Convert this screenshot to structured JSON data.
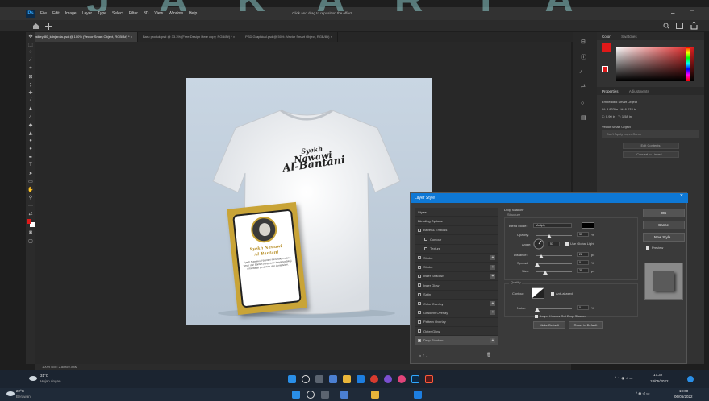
{
  "watermark": "JAKARTA",
  "menubar": {
    "logo": "Ps",
    "items": [
      "File",
      "Edit",
      "Image",
      "Layer",
      "Type",
      "Select",
      "Filter",
      "3D",
      "View",
      "Window",
      "Help"
    ],
    "hint": "Click and drag to reposition the effect.",
    "minimize": "–",
    "restore": "❐"
  },
  "tabs": [
    "postkey 80_kdnjardia.psd @ 100% (Vector Smart Object, RGB/8#) * ×",
    "Baru produk.psd @ 33.3% (Free Design Here copy, RGB/8#) * ×",
    "PSD Graphical.psd @ 50% (Vector Smart Object, RGB/8#) ×"
  ],
  "statusbar": "100%    Doc: 2.88M/2.88M",
  "shirt": {
    "print_line1": "Syekh",
    "print_line2": "Nawawi",
    "print_line3": "Al-Bantani"
  },
  "card": {
    "name_line1": "Syekh Nawawi",
    "name_line2": "Al-Bantani",
    "body": "Syekh Nawawi al-Bantani merupakan ulama besar dari Banten yang karya-karyanya dikaji di berbagai pesantren dan dunia Islam."
  },
  "right_panel": {
    "color_tab": "Color",
    "swatches_tab": "Swatches",
    "properties_tab": "Properties",
    "adjustments_tab": "Adjustments",
    "smart_object": "Embedded Smart Object",
    "w_label": "W:",
    "w_value": "5.833 in",
    "h_label": "H:",
    "h_value": "6.033 in",
    "x_value": "0.90 in",
    "y_value": "1.58 in",
    "vso_title": "Vector Smart Object",
    "vso_field": "Don't Apply Layer Comp",
    "edit_contents": "Edit Contents",
    "convert": "Convert to Linked..."
  },
  "dialog": {
    "title": "Layer Style",
    "close": "×",
    "styles": [
      {
        "label": "Styles",
        "type": "header"
      },
      {
        "label": "Blending Options",
        "type": "header"
      },
      {
        "label": "Bevel & Emboss",
        "checked": false
      },
      {
        "label": "Contour",
        "checked": false,
        "indent": true
      },
      {
        "label": "Texture",
        "checked": false,
        "indent": true
      },
      {
        "label": "Stroke",
        "checked": false,
        "plus": true
      },
      {
        "label": "Stroke",
        "checked": false,
        "plus": true
      },
      {
        "label": "Inner Shadow",
        "checked": false,
        "plus": true
      },
      {
        "label": "Inner Glow",
        "checked": false
      },
      {
        "label": "Satin",
        "checked": false
      },
      {
        "label": "Color Overlay",
        "checked": false,
        "plus": true
      },
      {
        "label": "Gradient Overlay",
        "checked": false,
        "plus": true
      },
      {
        "label": "Pattern Overlay",
        "checked": false
      },
      {
        "label": "Outer Glow",
        "checked": false
      },
      {
        "label": "Drop Shadow",
        "checked": true,
        "plus": true,
        "selected": true
      }
    ],
    "fx_icons": "fx  ⇡  ⇣",
    "trash": "🗑",
    "section": "Drop Shadow",
    "structure": "Structure",
    "blend_mode_label": "Blend Mode:",
    "blend_mode": "Multiply",
    "opacity_label": "Opacity:",
    "opacity": "35",
    "angle_label": "Angle:",
    "angle": "53",
    "use_global": "Use Global Light",
    "distance_label": "Distance:",
    "distance": "22",
    "spread_label": "Spread:",
    "spread": "0",
    "size_label": "Size:",
    "size": "35",
    "unit_pct": "%",
    "unit_px": "px",
    "quality": "Quality",
    "contour_label": "Contour:",
    "anti_aliased": "Anti-aliased",
    "noise_label": "Noise:",
    "noise": "0",
    "knockout": "Layer Knocks Out Drop Shadow",
    "make_default": "Make Default",
    "reset_default": "Reset to Default",
    "ok": "OK",
    "cancel": "Cancel",
    "new_style": "New Style...",
    "preview": "Preview",
    "colors": {
      "shadow": "#000000",
      "accent": "#0e78d5"
    }
  },
  "taskbar1": {
    "temp": "31°C",
    "weather": "Hujan ringan",
    "time": "17:32",
    "date": "18/05/2022"
  },
  "taskbar2": {
    "temp": "22°C",
    "weather": "Berawan",
    "time": "19:00",
    "date": "06/06/2022"
  }
}
